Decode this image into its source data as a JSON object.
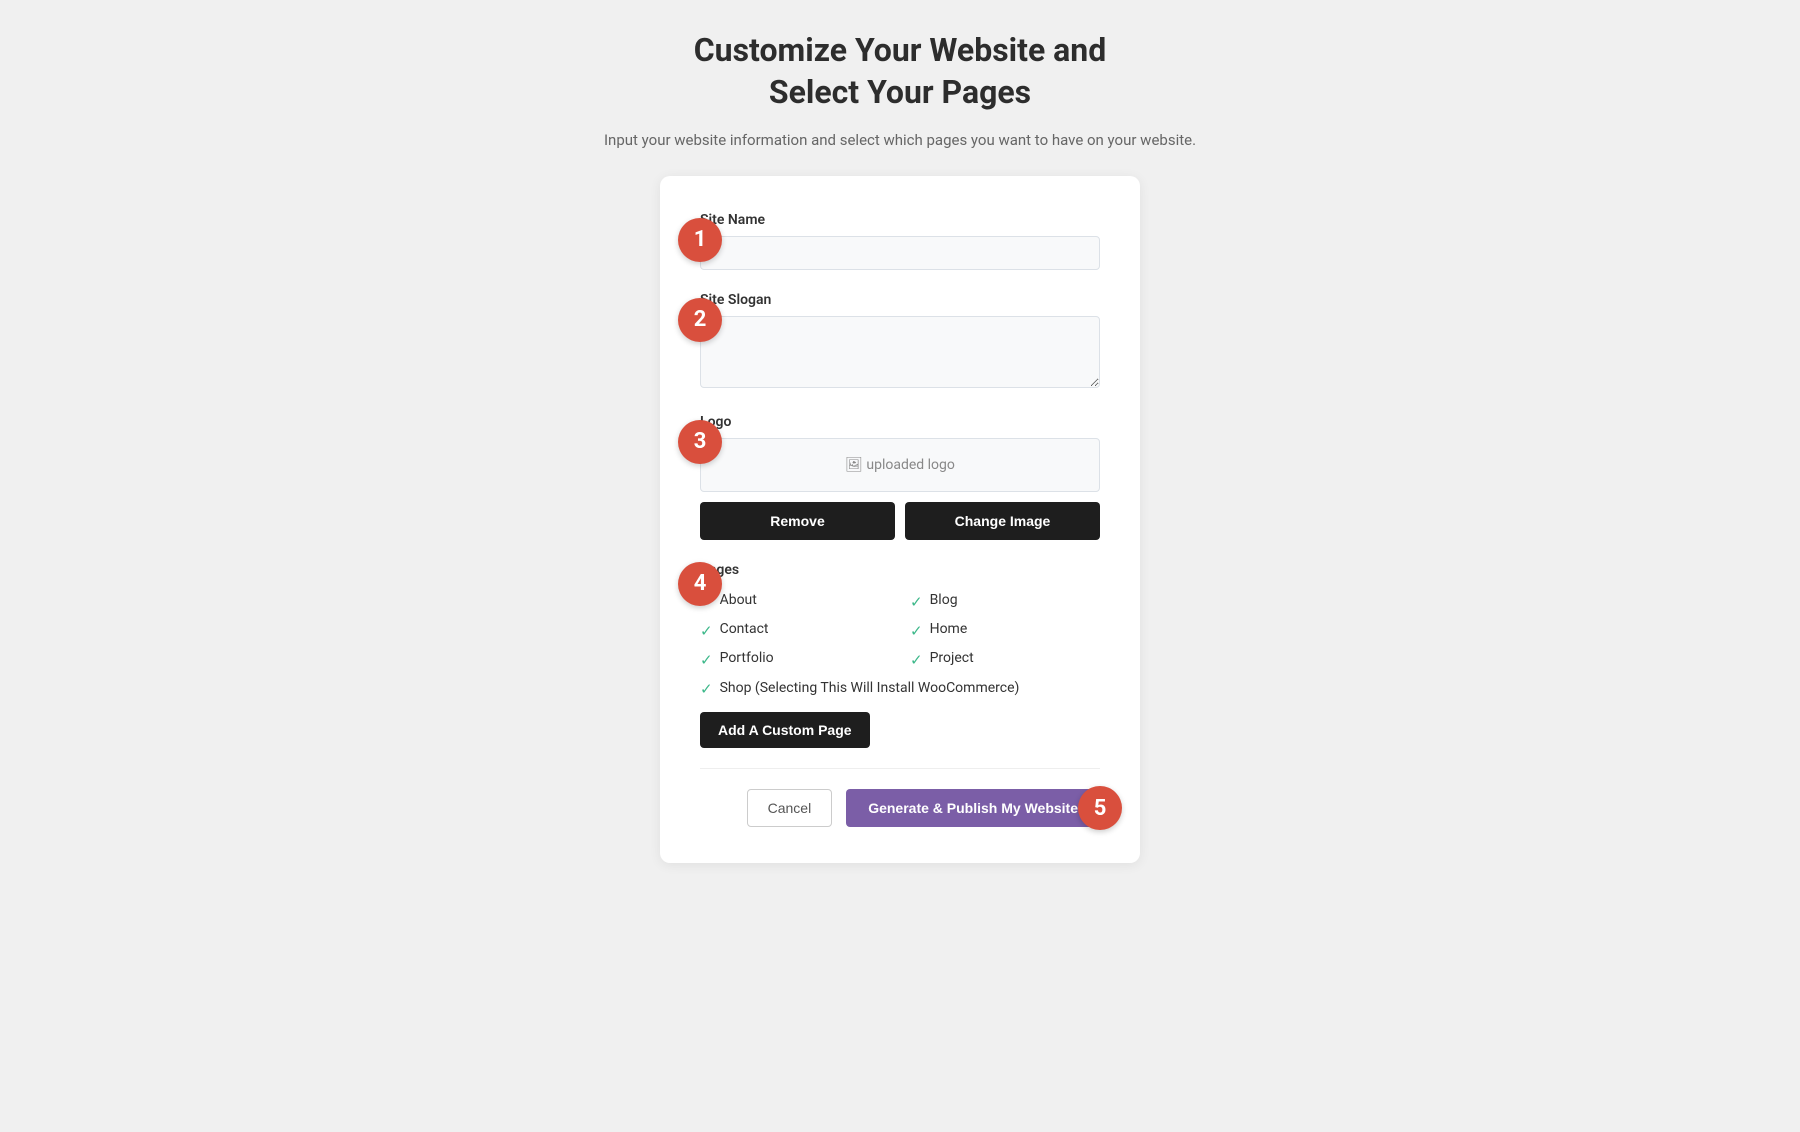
{
  "page": {
    "title_line1": "Customize Your Website and",
    "title_line2": "Select Your Pages",
    "subtitle": "Input your website information and select which pages you want to have on your website."
  },
  "steps": {
    "step1": "1",
    "step2": "2",
    "step3": "3",
    "step4": "4",
    "step5": "5"
  },
  "form": {
    "site_name_label": "Site Name",
    "site_name_placeholder": "",
    "site_slogan_label": "Site Slogan",
    "site_slogan_placeholder": "",
    "logo_label": "Logo",
    "logo_preview_text": "uploaded logo",
    "remove_button": "Remove",
    "change_image_button": "Change Image",
    "pages_label": "Pages",
    "pages": [
      {
        "name": "About",
        "checked": true
      },
      {
        "name": "Blog",
        "checked": true
      },
      {
        "name": "Contact",
        "checked": true
      },
      {
        "name": "Home",
        "checked": true
      },
      {
        "name": "Portfolio",
        "checked": true
      },
      {
        "name": "Project",
        "checked": true
      }
    ],
    "shop_page_label": "Shop (Selecting This Will Install WooCommerce)",
    "shop_checked": true,
    "add_custom_page_button": "Add A Custom Page",
    "cancel_button": "Cancel",
    "generate_button": "Generate & Publish My Website"
  }
}
